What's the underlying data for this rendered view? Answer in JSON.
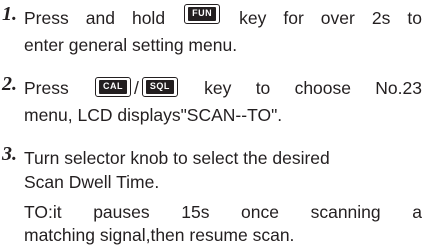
{
  "steps": [
    {
      "number": "1.",
      "line1_words": [
        "Press",
        "and",
        "hold",
        "{key}",
        "key",
        "for",
        "over",
        "2s",
        "to"
      ],
      "key_label": "FUN",
      "line2": "enter general setting menu."
    },
    {
      "number": "2.",
      "line1_before": "Press",
      "key_label_a": "CAL",
      "separator": "/",
      "key_label_b": "SQL",
      "line1_after_words": [
        "key",
        "to",
        "choose",
        "No.23"
      ],
      "line2": "menu, LCD displays\"SCAN--TO\"."
    },
    {
      "number": "3.",
      "line1": "Turn selector knob to select the desired",
      "line2": "Scan Dwell Time."
    }
  ],
  "note": {
    "line1_words": [
      "TO:it",
      "pauses",
      "15s",
      "once",
      "scanning",
      "a"
    ],
    "line2": "matching signal,then resume scan."
  }
}
